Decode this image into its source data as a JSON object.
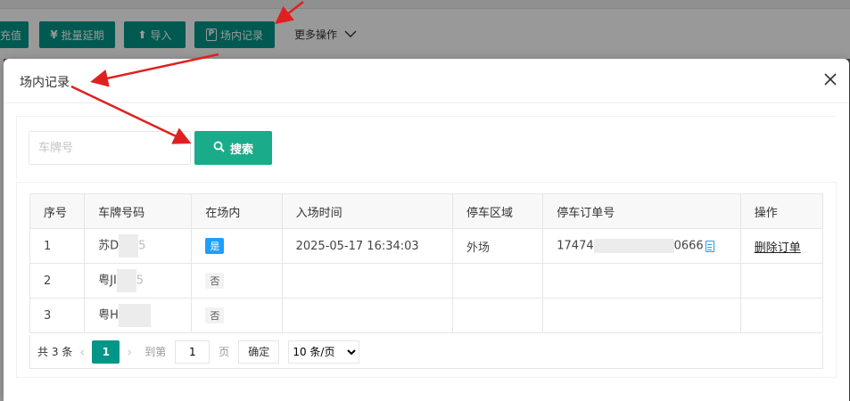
{
  "toolbar": {
    "recharge": "充值",
    "batch_extend": "批量延期",
    "import": "导入",
    "in_lot_records": "场内记录",
    "more_ops": "更多操作"
  },
  "modal": {
    "title": "场内记录",
    "search_placeholder": "车牌号",
    "search_label": "搜索"
  },
  "table": {
    "headers": [
      "序号",
      "车牌号码",
      "在场内",
      "入场时间",
      "停车区域",
      "停车订单号",
      "操作"
    ],
    "rows": [
      {
        "no": "1",
        "plate_prefix": "苏D",
        "plate_suffix": "5",
        "in_lot": "是",
        "entry_time": "2025-05-17 16:34:03",
        "area": "外场",
        "order_prefix": "17474",
        "order_suffix": "0666",
        "action": "删除订单"
      },
      {
        "no": "2",
        "plate_prefix": "粤JI",
        "plate_suffix": "5",
        "in_lot": "否",
        "entry_time": "",
        "area": "",
        "order_prefix": "",
        "order_suffix": "",
        "action": ""
      },
      {
        "no": "3",
        "plate_prefix": "粤H",
        "plate_suffix": "",
        "in_lot": "否",
        "entry_time": "",
        "area": "",
        "order_prefix": "",
        "order_suffix": "",
        "action": ""
      }
    ]
  },
  "pager": {
    "total": "共 3 条",
    "current_page": "1",
    "goto_label": "到第",
    "goto_value": "1",
    "page_label": "页",
    "confirm": "确定",
    "page_size": "10 条/页"
  },
  "colors": {
    "primary": "#009688",
    "search_button": "#1aac8a",
    "tag_yes": "#1e9fff",
    "annotation_arrow": "#e02020"
  }
}
